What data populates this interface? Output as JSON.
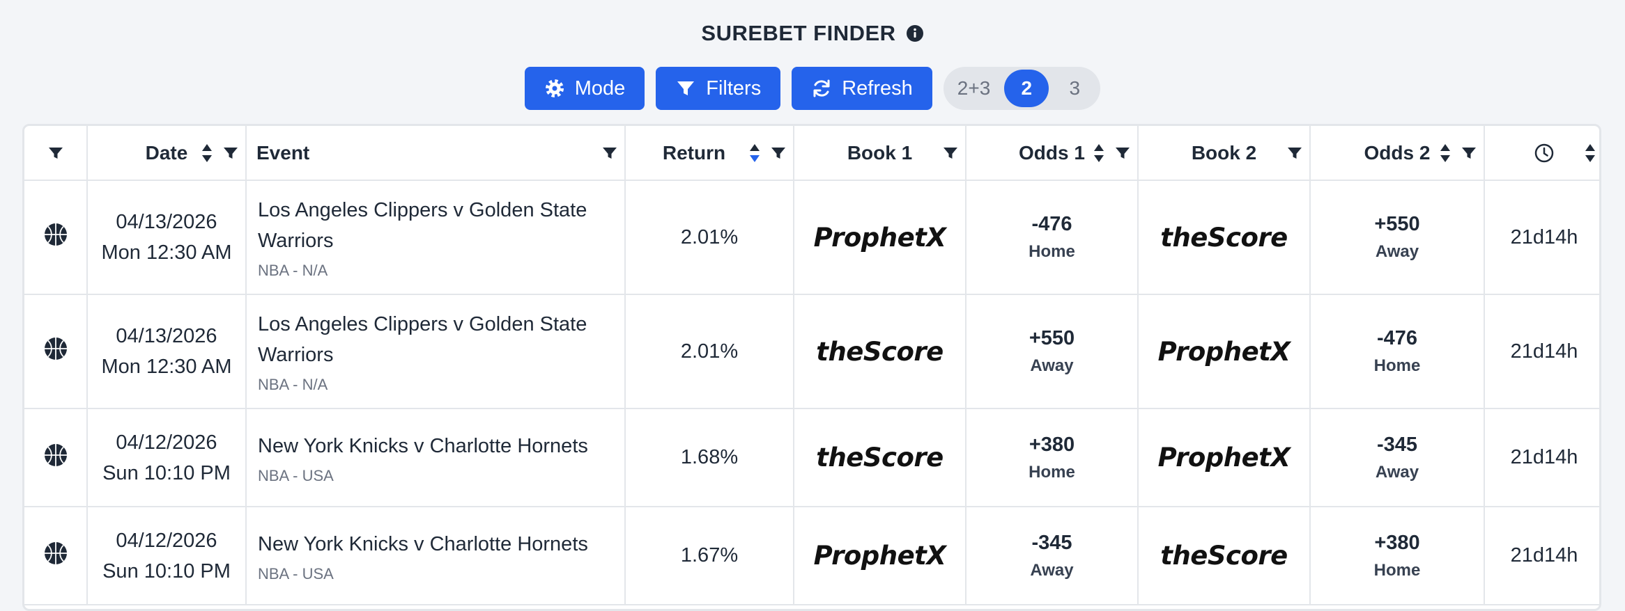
{
  "header": {
    "title": "SUREBET FINDER",
    "info_icon": "info-icon"
  },
  "toolbar": {
    "mode_label": "Mode",
    "filters_label": "Filters",
    "refresh_label": "Refresh",
    "segments": [
      "2+3",
      "2",
      "3"
    ],
    "active_segment": "2"
  },
  "colors": {
    "accent": "#2563eb",
    "background": "#f3f5f8",
    "border": "#e3e6ea"
  },
  "table": {
    "columns": {
      "date": "Date",
      "event": "Event",
      "return": "Return",
      "book1": "Book 1",
      "odds1": "Odds 1",
      "book2": "Book 2",
      "odds2": "Odds 2",
      "time_icon": "clock-icon"
    },
    "rows": [
      {
        "sport_icon": "basketball-icon",
        "date": "04/13/2026",
        "time": "Mon 12:30 AM",
        "event": "Los Angeles Clippers v Golden State Warriors",
        "league": "NBA - N/A",
        "return": "2.01%",
        "book1": "ProphetX",
        "odds1": "-476",
        "side1": "Home",
        "book2": "theScore",
        "odds2": "+550",
        "side2": "Away",
        "age": "21d14h"
      },
      {
        "sport_icon": "basketball-icon",
        "date": "04/13/2026",
        "time": "Mon 12:30 AM",
        "event": "Los Angeles Clippers v Golden State Warriors",
        "league": "NBA - N/A",
        "return": "2.01%",
        "book1": "theScore",
        "odds1": "+550",
        "side1": "Away",
        "book2": "ProphetX",
        "odds2": "-476",
        "side2": "Home",
        "age": "21d14h"
      },
      {
        "sport_icon": "basketball-icon",
        "date": "04/12/2026",
        "time": "Sun 10:10 PM",
        "event": "New York Knicks v Charlotte Hornets",
        "league": "NBA - USA",
        "return": "1.68%",
        "book1": "theScore",
        "odds1": "+380",
        "side1": "Home",
        "book2": "ProphetX",
        "odds2": "-345",
        "side2": "Away",
        "age": "21d14h"
      },
      {
        "sport_icon": "basketball-icon",
        "date": "04/12/2026",
        "time": "Sun 10:10 PM",
        "event": "New York Knicks v Charlotte Hornets",
        "league": "NBA - USA",
        "return": "1.67%",
        "book1": "ProphetX",
        "odds1": "-345",
        "side1": "Away",
        "book2": "theScore",
        "odds2": "+380",
        "side2": "Home",
        "age": "21d14h"
      }
    ]
  }
}
